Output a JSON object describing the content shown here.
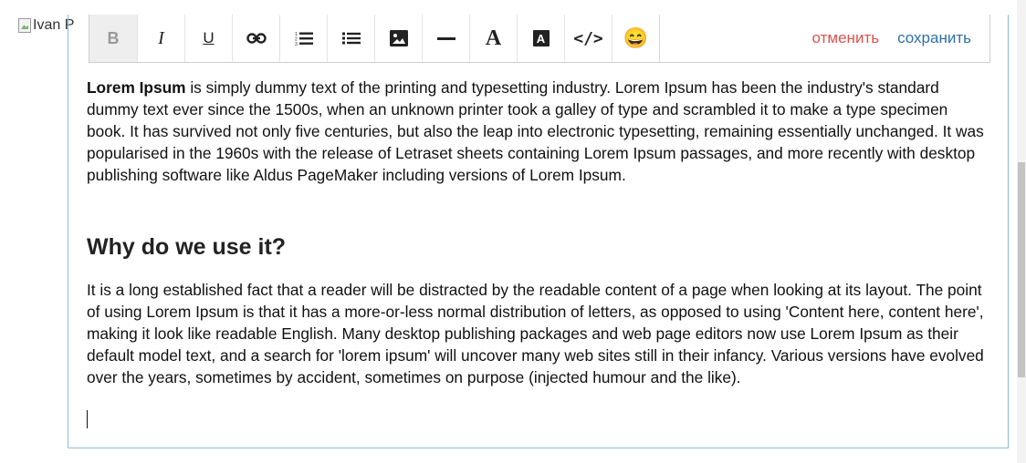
{
  "avatar": {
    "alt_text": "Ivan P"
  },
  "toolbar": {
    "bold": "B",
    "italic": "I",
    "underline": "U",
    "font_color": "A",
    "highlight": "A",
    "code": "</>",
    "emoji": "😄",
    "cancel_label": "отменить",
    "save_label": "сохранить"
  },
  "content": {
    "p1_bold": "Lorem Ipsum",
    "p1_rest": " is simply dummy text of the printing and typesetting industry. Lorem Ipsum has been the industry's standard dummy text ever since the 1500s, when an unknown printer took a galley of type and scrambled it to make a type specimen book. It has survived not only five centuries, but also the leap into electronic typesetting, remaining essentially unchanged. It was popularised in the 1960s with the release of Letraset sheets containing Lorem Ipsum passages, and more recently with desktop publishing software like Aldus PageMaker including versions of Lorem Ipsum.",
    "heading": "Why do we use it?",
    "p2": "It is a long established fact that a reader will be distracted by the readable content of a page when looking at its layout. The point of using Lorem Ipsum is that it has a more-or-less normal distribution of letters, as opposed to using 'Content here, content here', making it look like readable English. Many desktop publishing packages and web page editors now use Lorem Ipsum as their default model text, and a search for 'lorem ipsum' will uncover many web sites still in their infancy. Various versions have evolved over the years, sometimes by accident, sometimes on purpose (injected humour and the like)."
  },
  "colors": {
    "cancel": "#d9534f",
    "save": "#2f6fa8",
    "editor_border": "#8fbcd6"
  },
  "icons": [
    "bold-icon",
    "italic-icon",
    "underline-icon",
    "link-icon",
    "ordered-list-icon",
    "bullet-list-icon",
    "image-icon",
    "horizontal-rule-icon",
    "font-color-icon",
    "highlight-icon",
    "code-icon",
    "emoji-icon"
  ]
}
